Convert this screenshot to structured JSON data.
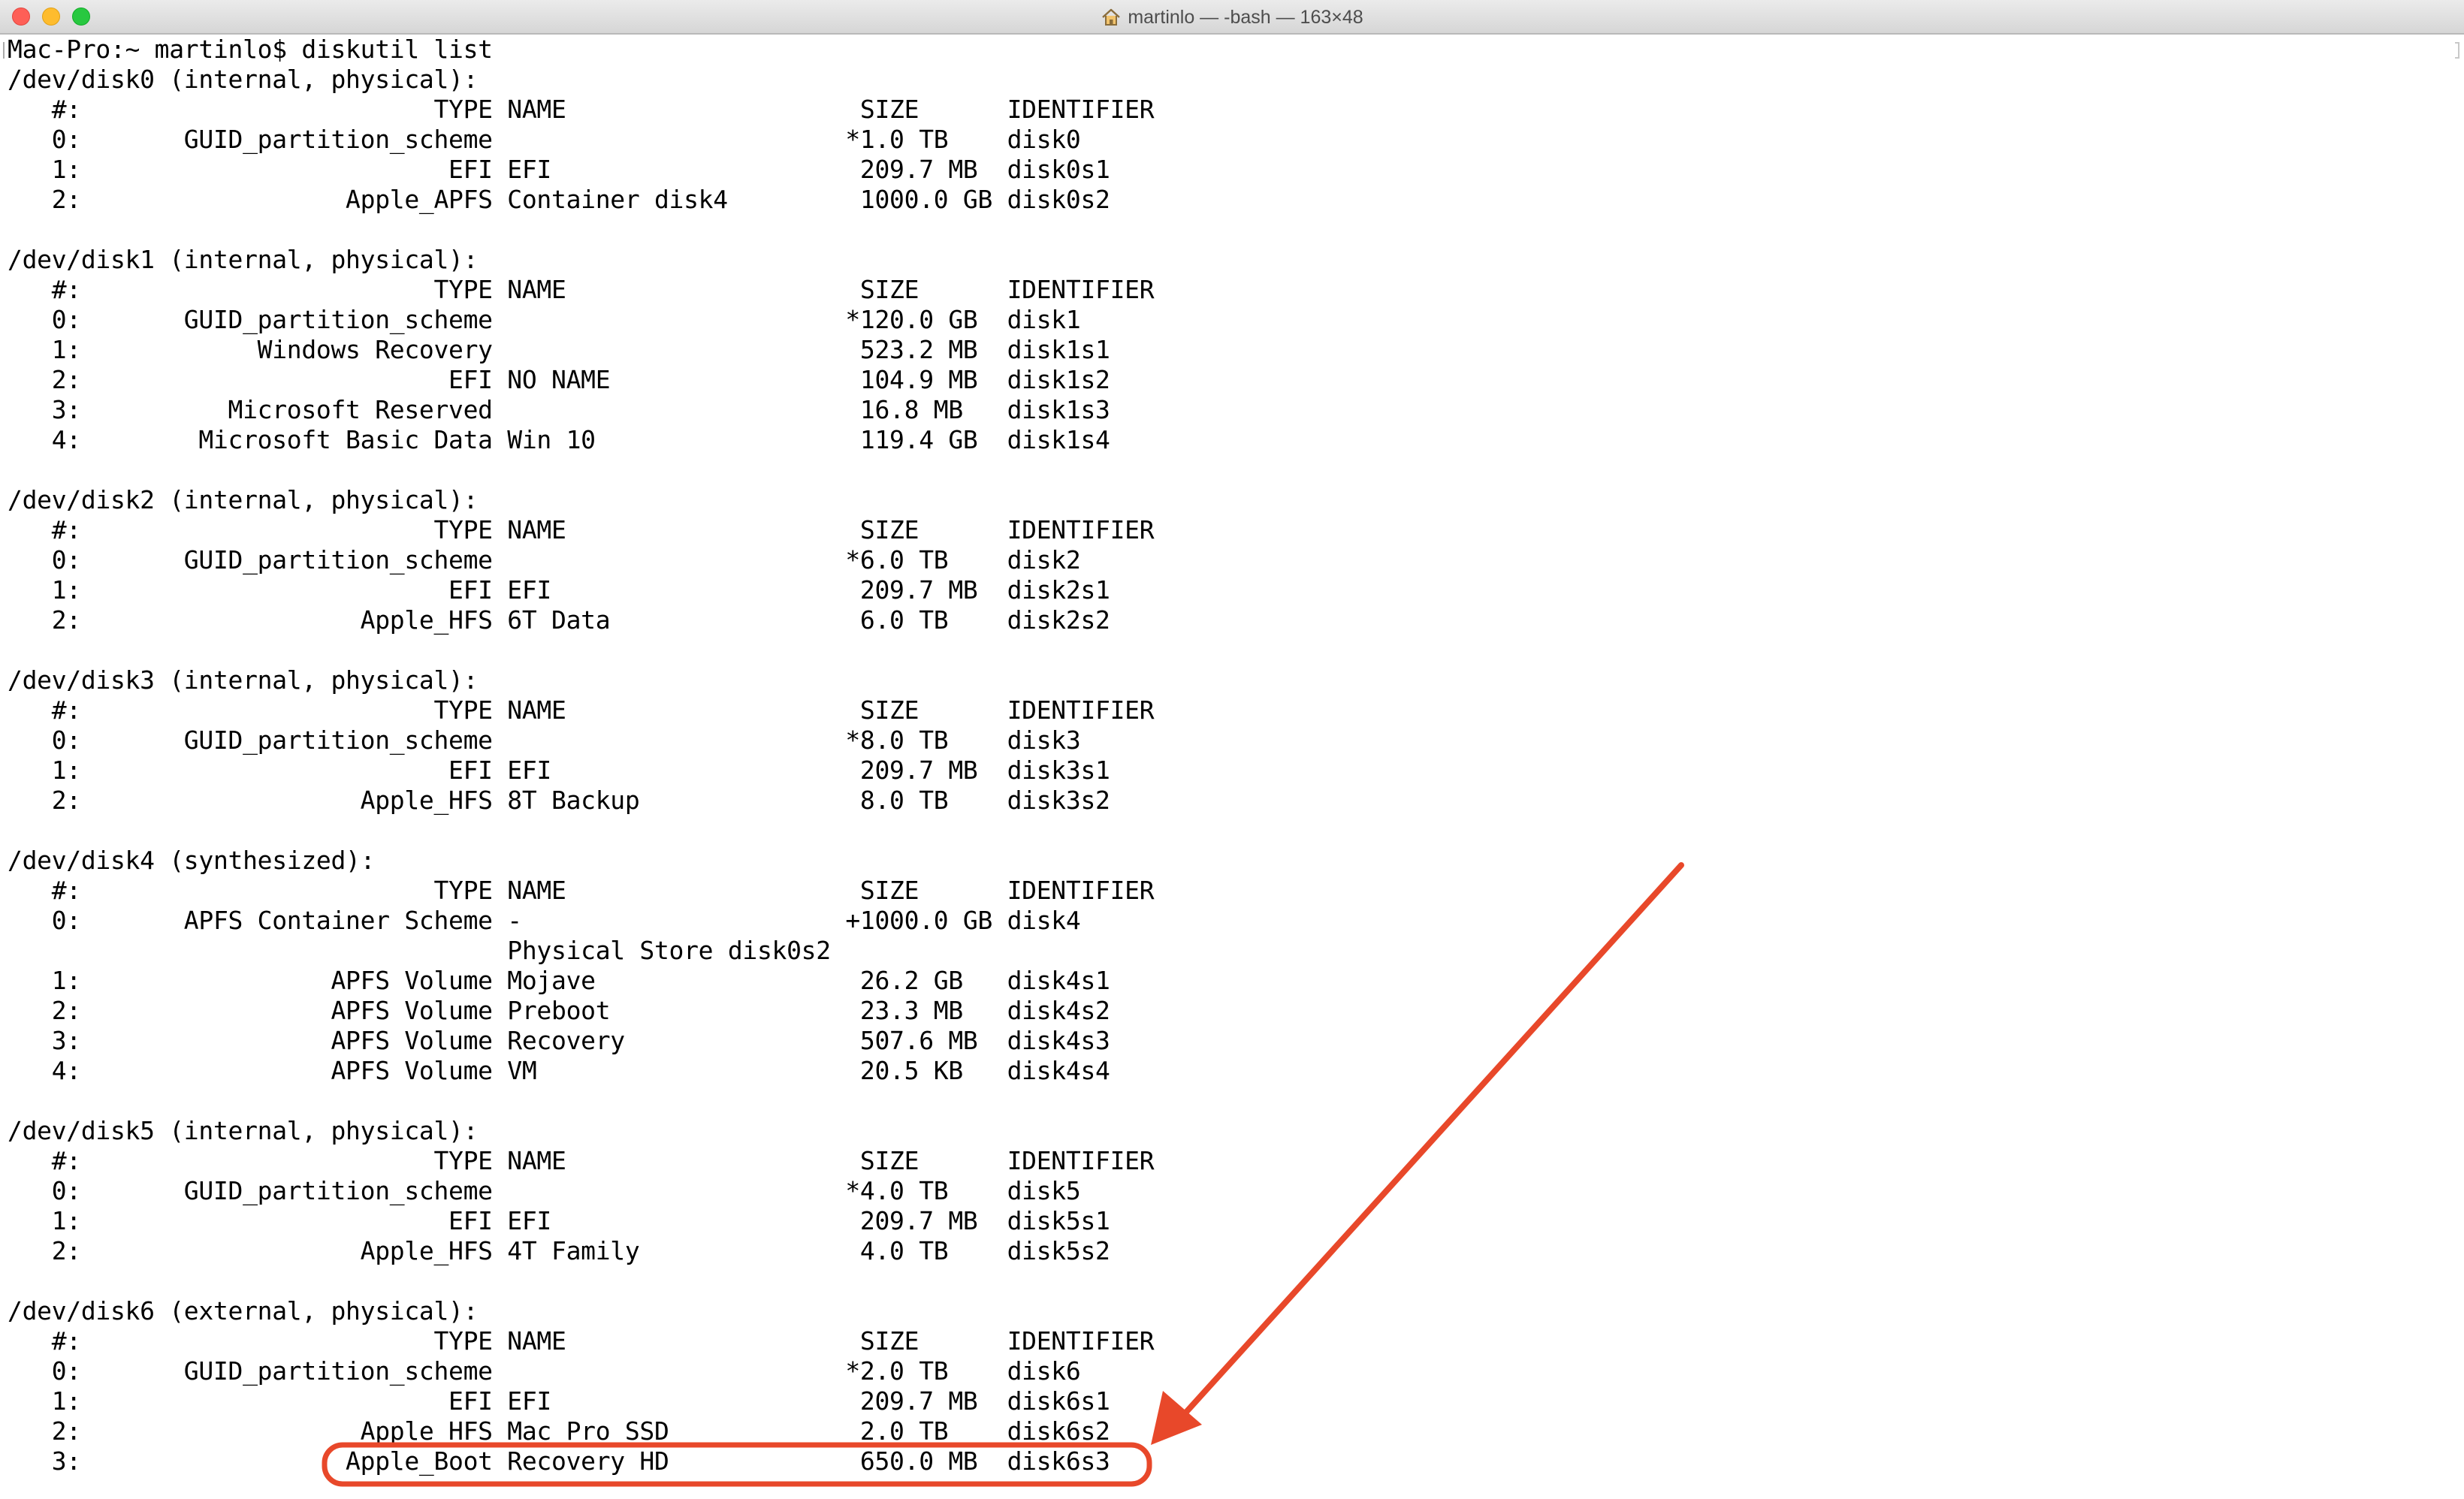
{
  "window": {
    "title": "martinlo — -bash — 163×48",
    "title_icon": "home-folder-icon",
    "controls": [
      "close",
      "minimize",
      "zoom"
    ]
  },
  "terminal": {
    "prompt": "Mac-Pro:~ martinlo$ diskutil list",
    "disks": [
      {
        "header": "/dev/disk0 (internal, physical):",
        "columns": [
          "#:",
          "TYPE",
          "NAME",
          "SIZE",
          "IDENTIFIER"
        ],
        "rows": [
          [
            "0:",
            "GUID_partition_scheme",
            "",
            "*1.0 TB",
            "disk0"
          ],
          [
            "1:",
            "EFI",
            "EFI",
            "209.7 MB",
            "disk0s1"
          ],
          [
            "2:",
            "Apple_APFS",
            "Container disk4",
            "1000.0 GB",
            "disk0s2"
          ]
        ]
      },
      {
        "header": "/dev/disk1 (internal, physical):",
        "columns": [
          "#:",
          "TYPE",
          "NAME",
          "SIZE",
          "IDENTIFIER"
        ],
        "rows": [
          [
            "0:",
            "GUID_partition_scheme",
            "",
            "*120.0 GB",
            "disk1"
          ],
          [
            "1:",
            "Windows Recovery",
            "",
            "523.2 MB",
            "disk1s1"
          ],
          [
            "2:",
            "EFI",
            "NO NAME",
            "104.9 MB",
            "disk1s2"
          ],
          [
            "3:",
            "Microsoft Reserved",
            "",
            "16.8 MB",
            "disk1s3"
          ],
          [
            "4:",
            "Microsoft Basic Data",
            "Win 10",
            "119.4 GB",
            "disk1s4"
          ]
        ]
      },
      {
        "header": "/dev/disk2 (internal, physical):",
        "columns": [
          "#:",
          "TYPE",
          "NAME",
          "SIZE",
          "IDENTIFIER"
        ],
        "rows": [
          [
            "0:",
            "GUID_partition_scheme",
            "",
            "*6.0 TB",
            "disk2"
          ],
          [
            "1:",
            "EFI",
            "EFI",
            "209.7 MB",
            "disk2s1"
          ],
          [
            "2:",
            "Apple_HFS",
            "6T Data",
            "6.0 TB",
            "disk2s2"
          ]
        ]
      },
      {
        "header": "/dev/disk3 (internal, physical):",
        "columns": [
          "#:",
          "TYPE",
          "NAME",
          "SIZE",
          "IDENTIFIER"
        ],
        "rows": [
          [
            "0:",
            "GUID_partition_scheme",
            "",
            "*8.0 TB",
            "disk3"
          ],
          [
            "1:",
            "EFI",
            "EFI",
            "209.7 MB",
            "disk3s1"
          ],
          [
            "2:",
            "Apple_HFS",
            "8T Backup",
            "8.0 TB",
            "disk3s2"
          ]
        ]
      },
      {
        "header": "/dev/disk4 (synthesized):",
        "columns": [
          "#:",
          "TYPE",
          "NAME",
          "SIZE",
          "IDENTIFIER"
        ],
        "rows": [
          [
            "0:",
            "APFS Container Scheme",
            "-",
            "+1000.0 GB",
            "disk4"
          ],
          [
            "",
            "",
            "Physical Store disk0s2",
            "",
            ""
          ],
          [
            "1:",
            "APFS Volume",
            "Mojave",
            "26.2 GB",
            "disk4s1"
          ],
          [
            "2:",
            "APFS Volume",
            "Preboot",
            "23.3 MB",
            "disk4s2"
          ],
          [
            "3:",
            "APFS Volume",
            "Recovery",
            "507.6 MB",
            "disk4s3"
          ],
          [
            "4:",
            "APFS Volume",
            "VM",
            "20.5 KB",
            "disk4s4"
          ]
        ]
      },
      {
        "header": "/dev/disk5 (internal, physical):",
        "columns": [
          "#:",
          "TYPE",
          "NAME",
          "SIZE",
          "IDENTIFIER"
        ],
        "rows": [
          [
            "0:",
            "GUID_partition_scheme",
            "",
            "*4.0 TB",
            "disk5"
          ],
          [
            "1:",
            "EFI",
            "EFI",
            "209.7 MB",
            "disk5s1"
          ],
          [
            "2:",
            "Apple_HFS",
            "4T Family",
            "4.0 TB",
            "disk5s2"
          ]
        ]
      },
      {
        "header": "/dev/disk6 (external, physical):",
        "columns": [
          "#:",
          "TYPE",
          "NAME",
          "SIZE",
          "IDENTIFIER"
        ],
        "rows": [
          [
            "0:",
            "GUID_partition_scheme",
            "",
            "*2.0 TB",
            "disk6"
          ],
          [
            "1:",
            "EFI",
            "EFI",
            "209.7 MB",
            "disk6s1"
          ],
          [
            "2:",
            "Apple_HFS",
            "Mac Pro SSD",
            "2.0 TB",
            "disk6s2"
          ],
          [
            "3:",
            "Apple_Boot",
            "Recovery HD",
            "650.0 MB",
            "disk6s3"
          ]
        ]
      }
    ]
  },
  "annotation": {
    "color": "#e8482a",
    "highlighted_identifier": "disk6s3"
  }
}
